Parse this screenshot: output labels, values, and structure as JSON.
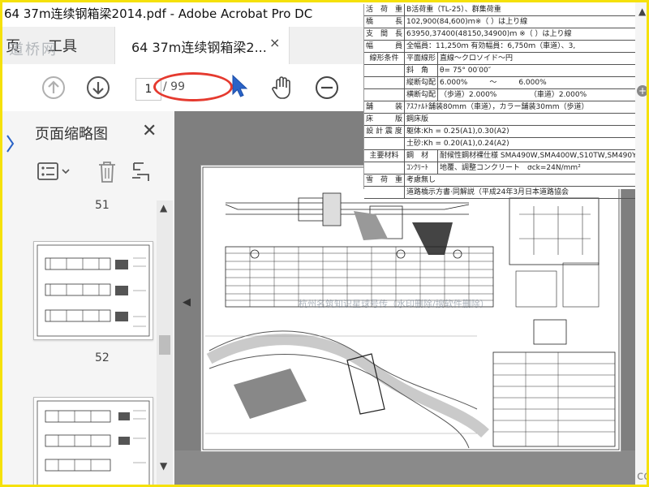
{
  "window": {
    "title": "64 37m连续钢箱梁2014.pdf - Adobe Acrobat Pro DC"
  },
  "menubar": {
    "home": "页",
    "tools": "工具"
  },
  "watermark_top": "道桥网",
  "document_tab": {
    "label": "64 37m连续钢箱梁2...",
    "close": "×"
  },
  "toolbar": {
    "prev_icon": "up-arrow-circle-icon",
    "next_icon": "down-arrow-circle-icon",
    "page_current": "1",
    "page_total": "/ 99",
    "select_icon": "cursor-arrow-icon",
    "hand_icon": "hand-icon",
    "zoom_out_icon": "minus-circle-icon"
  },
  "sidepanel": {
    "title": "页面缩略图",
    "close": "✕",
    "pages": [
      "51",
      "52"
    ]
  },
  "spec_table": {
    "rows": [
      {
        "label": "活　荷　重",
        "value": "B活荷重（TL-25）、群集荷重"
      },
      {
        "label": "橋　　　長",
        "value": "102,900(84,600)ｍ※（ ）は上り線"
      },
      {
        "label": "支　間　長",
        "value": "63950,37400(48150,34900)ｍ ※（ ）は上り線"
      },
      {
        "label": "幅　　　員",
        "value": "全幅員：11,250ｍ 有効幅員：6,750ｍ（車道）、3,"
      },
      {
        "label": "線形条件",
        "sub": "平面線形",
        "value": "直線～クロソイド～円"
      },
      {
        "label": "",
        "sub": "斜　角",
        "value": "θ= 75° 00′00″"
      },
      {
        "label": "",
        "sub": "縦断勾配",
        "value": "6.000%　　　～　　　6.000%"
      },
      {
        "label": "",
        "sub": "横断勾配",
        "value": "（歩道）2.000%　　　　　（車道）2.000%"
      },
      {
        "label": "舗　　　装",
        "value": "ｱｽﾌｧﾙﾄ舗装80mm（車道），カラー舗装30mm（歩道）"
      },
      {
        "label": "床　　　版",
        "value": "鋼床版"
      },
      {
        "label": "設 計 震 度",
        "value": "躯体:Kh = 0.25(A1),0.30(A2)"
      },
      {
        "label": "",
        "value": "土砂:Kh = 0.20(A1),0.24(A2)"
      },
      {
        "label": "主要材料",
        "sub": "鋼　材",
        "value": "耐候性鋼材裸仕様 SMA490W,SMA400W,S10TW,SM490Y"
      },
      {
        "label": "",
        "sub": "ｺﾝｸﾘｰﾄ",
        "value": "地覆、調整コンクリート　σck=24N/mm²"
      },
      {
        "label": "雪　荷　重",
        "value": "考慮無し"
      },
      {
        "label": "",
        "value": "道路橋示方書·同解説（平成24年3月日本道路協会"
      }
    ]
  },
  "drawing_watermark": "杭州名筑知识星球号传（水印删除/搜软件删除）",
  "watermark_bottom": "com",
  "colors": {
    "highlight": "#e53a2f",
    "border": "#f5e10a",
    "viewer_bg": "#7f7f7f"
  }
}
